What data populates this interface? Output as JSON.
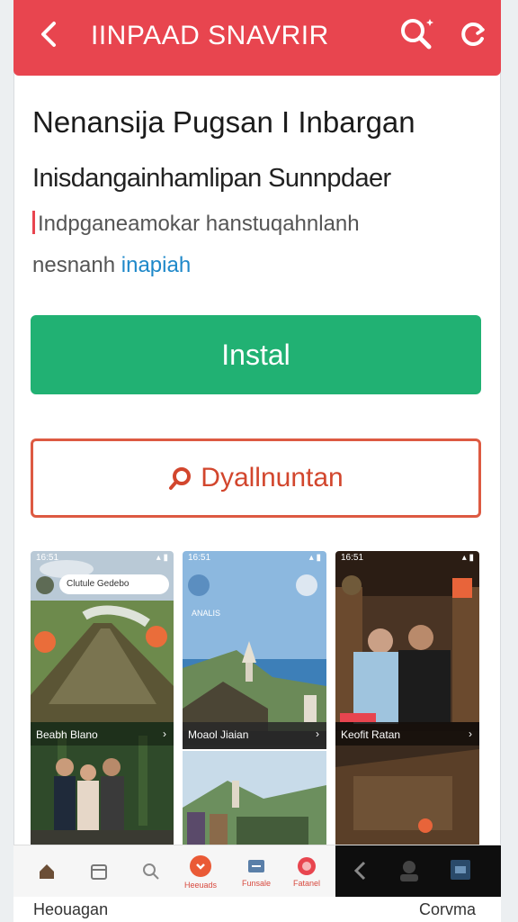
{
  "header": {
    "title": "IINPAAD SNAVRIR",
    "back_icon": "chevron-left-icon",
    "search_icon": "search-icon",
    "refresh_icon": "refresh-icon",
    "color": "#e8454f"
  },
  "app": {
    "title": "Nenansija Pugsan I Inbargan",
    "subtitle": "Inisdangainhamlipan Sunnpdaer",
    "description_line1": "Indpganeamokar hanstuqahnlanh",
    "description_line2_text": "nesnanh",
    "description_line2_link": "inapiah"
  },
  "buttons": {
    "install_label": "Instal",
    "install_color": "#21b173",
    "secondary_label": "Dyallnuntan",
    "secondary_icon": "pin-icon",
    "secondary_color": "#dd5a42"
  },
  "screenshots": [
    {
      "status_time": "16:51",
      "chip_label": "Clutule Gedebo",
      "caption": "Beabh Blano"
    },
    {
      "status_time": "16:51",
      "chip_label": "ANALIS",
      "caption": "Moaol Jiaian"
    },
    {
      "status_time": "16:51",
      "chip_label": "",
      "caption": "Keofit Ratan"
    }
  ],
  "bottom_nav": {
    "items": [
      {
        "label": "",
        "icon": "home-icon"
      },
      {
        "label": "",
        "icon": "calendar-icon"
      },
      {
        "label": "",
        "icon": "search-icon"
      },
      {
        "label": "Heeuads",
        "icon": "record-icon"
      },
      {
        "label": "Funsale",
        "icon": "image-icon"
      },
      {
        "label": "Fatanel",
        "icon": "heart-icon"
      }
    ],
    "dark_icons": [
      "back-icon",
      "avatar-icon",
      "settings-icon"
    ]
  },
  "footer": {
    "left": "Heouagan",
    "right": "Corvma"
  }
}
